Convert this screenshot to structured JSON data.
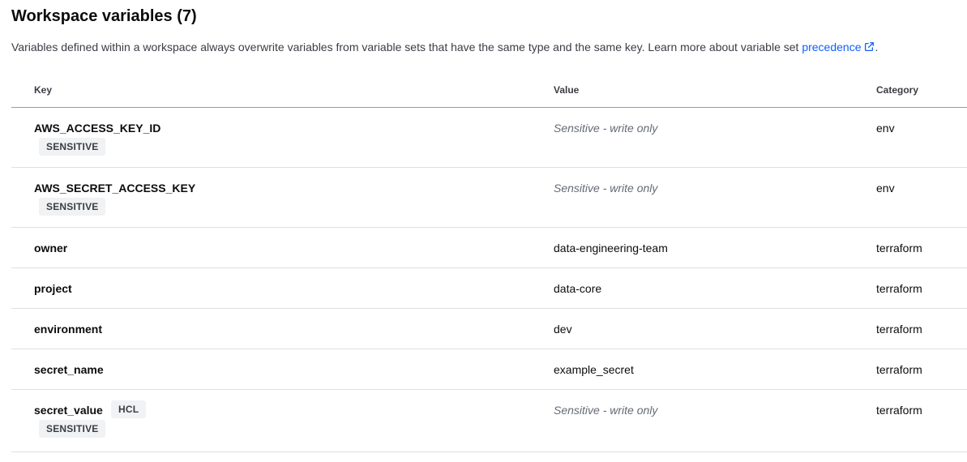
{
  "header": {
    "title": "Workspace variables (7)",
    "description": "Variables defined within a workspace always overwrite variables from variable sets that have the same type and the same key. Learn more about variable set ",
    "link_text": "precedence",
    "description_end": ".",
    "link_icon": "external-link-icon"
  },
  "table": {
    "columns": {
      "key": "Key",
      "value": "Value",
      "category": "Category"
    },
    "rows": [
      {
        "key": "AWS_ACCESS_KEY_ID",
        "value": "Sensitive - write only",
        "category": "env",
        "badge": "SENSITIVE"
      },
      {
        "key": "AWS_SECRET_ACCESS_KEY",
        "value": "Sensitive - write only",
        "category": "env",
        "badge": "SENSITIVE"
      },
      {
        "key": "owner",
        "value": "data-engineering-team",
        "category": "terraform"
      },
      {
        "key": "project",
        "value": "data-core",
        "category": "terraform"
      },
      {
        "key": "environment",
        "value": "dev",
        "category": "terraform"
      },
      {
        "key": "secret_name",
        "value": "example_secret",
        "category": "terraform"
      },
      {
        "key": "secret_value",
        "value": "Sensitive - write only",
        "category": "terraform",
        "inline_badge": "HCL",
        "badge": "SENSITIVE"
      }
    ]
  },
  "colors": {
    "link": "#1060ff",
    "badge_bg": "#f1f2f3",
    "sensitive_text": "#656a76",
    "row_border": "#dedfe3",
    "header_border": "#9a9ca4"
  }
}
